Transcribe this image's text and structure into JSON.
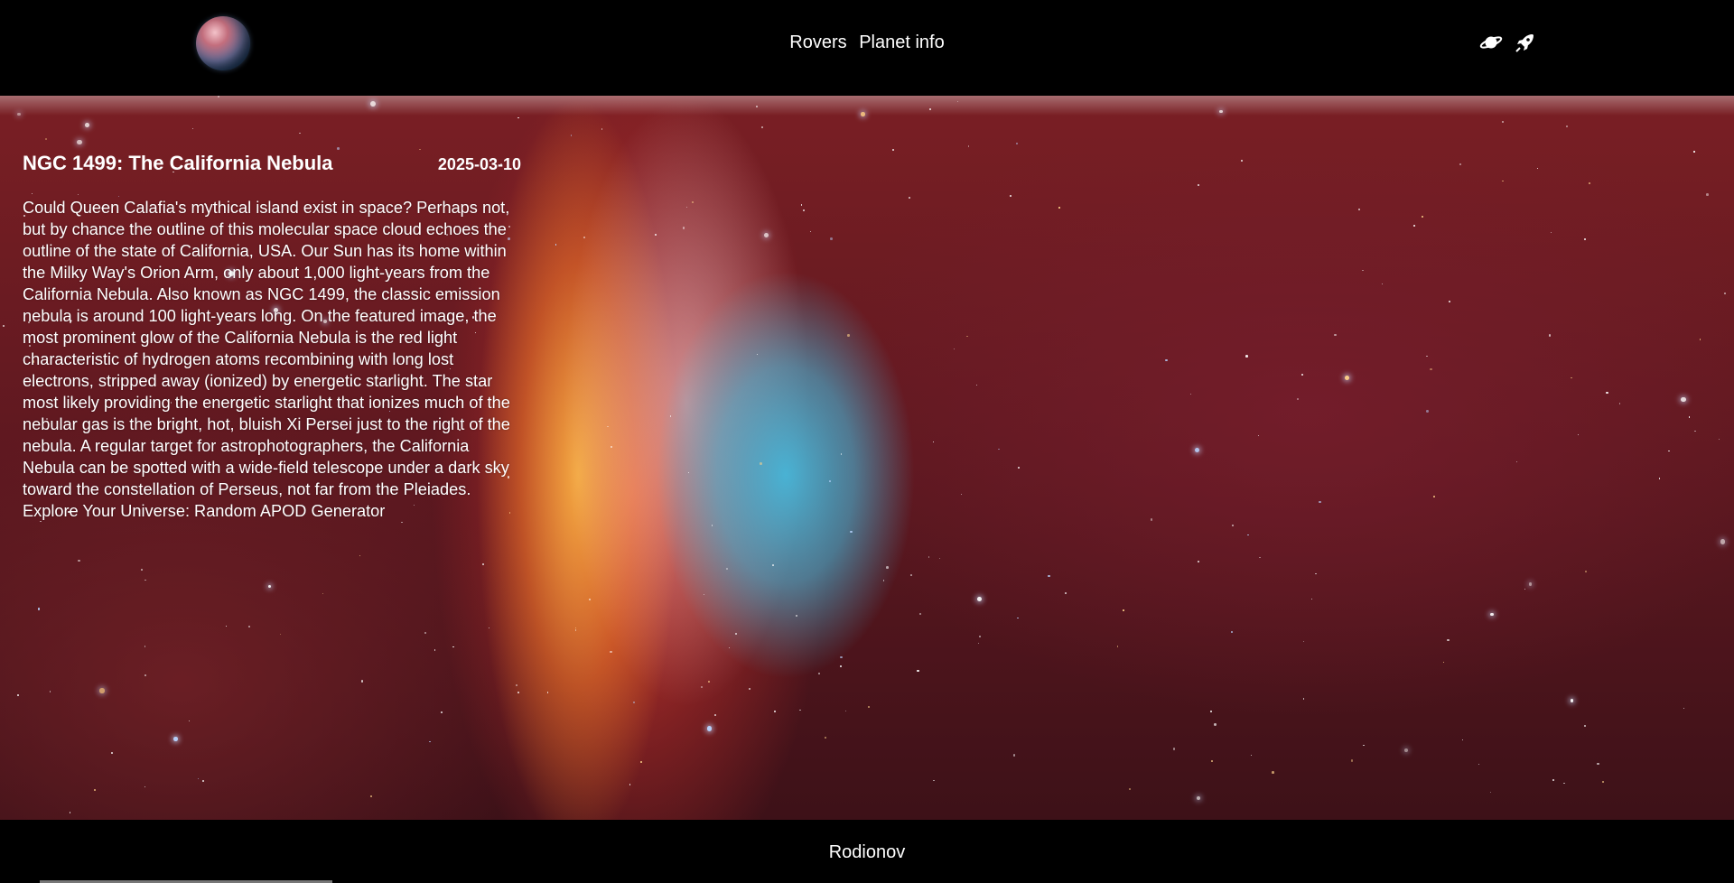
{
  "header": {
    "logo_icon": "planet-logo-icon",
    "nav": {
      "rovers": "Rovers",
      "planet_info": "Planet info"
    },
    "icons": [
      "saturn-icon",
      "rocket-icon"
    ]
  },
  "apod": {
    "title": "NGC 1499: The California Nebula",
    "date": "2025-03-10",
    "explanation": "Could Queen Calafia's mythical island exist in space? Perhaps not, but by chance the outline of this molecular space cloud echoes the outline of the state of California, USA. Our Sun has its home within the Milky Way's Orion Arm, only about 1,000 light-years from the California Nebula. Also known as NGC 1499, the classic emission nebula is around 100 light-years long. On the featured image, the most prominent glow of the California Nebula is the red light characteristic of hydrogen atoms recombining with long lost electrons, stripped away (ionized) by energetic starlight. The star most likely providing the energetic starlight that ionizes much of the nebular gas is the bright, hot, bluish Xi Persei just to the right of the nebula. A regular target for astrophotographers, the California Nebula can be spotted with a wide-field telescope under a dark sky toward the constellation of Perseus, not far from the Pleiades. Explore Your Universe: Random APOD Generator"
  },
  "footer": {
    "author": "Rodionov"
  },
  "colors": {
    "header_bg": "#000000",
    "text": "#ffffff",
    "nebula_red": "#7a1f24",
    "nebula_blue": "#46b9dc"
  }
}
